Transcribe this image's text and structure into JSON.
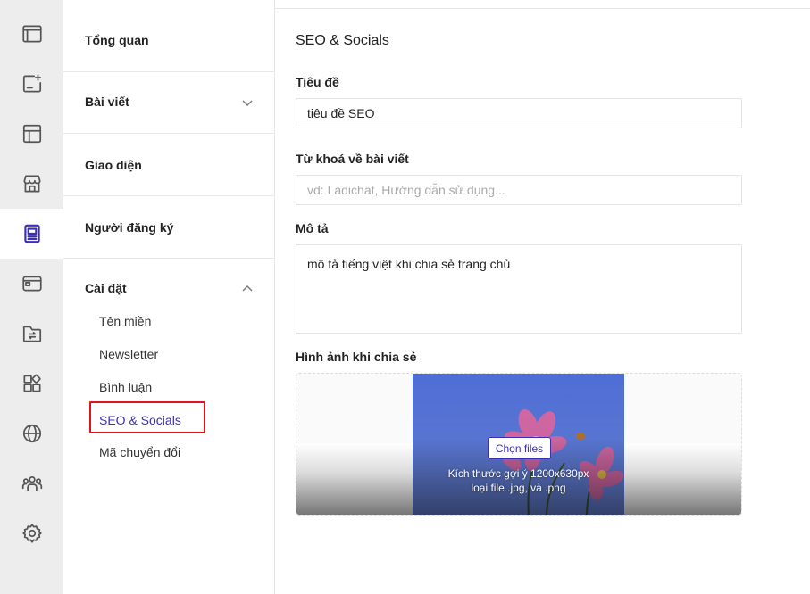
{
  "rail": {
    "icons": [
      "browser-window-icon",
      "add-post-icon",
      "layout-icon",
      "store-icon",
      "article-icon",
      "card-icon",
      "folder-sync-icon",
      "apps-icon",
      "globe-icon",
      "users-icon",
      "settings-icon"
    ],
    "active_index": 4,
    "accent": "#3b2fb5"
  },
  "menu": {
    "overview": "Tổng quan",
    "posts": "Bài viết",
    "appearance": "Giao diện",
    "subscribers": "Người đăng ký",
    "settings": "Cài đặt",
    "settings_items": [
      "Tên miền",
      "Newsletter",
      "Bình luận",
      "SEO & Socials",
      "Mã chuyển đổi"
    ]
  },
  "main": {
    "title": "SEO & Socials",
    "title_label": "Tiêu đề",
    "title_value": "tiêu đề SEO",
    "keywords_label": "Từ khoá về bài viết",
    "keywords_placeholder": "vd: Ladichat, Hướng dẫn sử dụng...",
    "description_label": "Mô tả",
    "description_value": "mô tả tiếng việt khi chia sẻ trang chủ",
    "image_label": "Hình ảnh khi chia sẻ",
    "choose_files": "Chọn files",
    "size_hint": "Kích thước gợi ý 1200x630px",
    "type_hint": "loại file .jpg, và .png"
  },
  "colors": {
    "accent": "#3b2fb5",
    "highlight_box": "#e0141e"
  }
}
